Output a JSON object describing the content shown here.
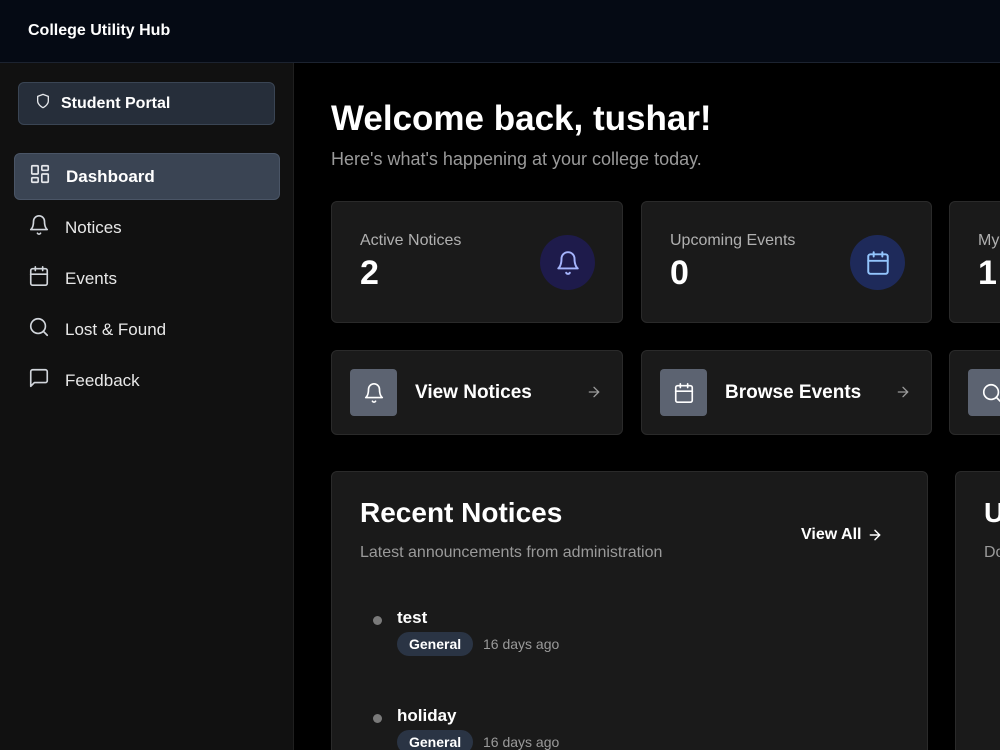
{
  "app": {
    "title": "College Utility Hub"
  },
  "sidebar": {
    "portal_label": "Student Portal",
    "items": [
      {
        "label": "Dashboard",
        "icon": "dashboard-icon",
        "active": true
      },
      {
        "label": "Notices",
        "icon": "bell-icon",
        "active": false
      },
      {
        "label": "Events",
        "icon": "calendar-icon",
        "active": false
      },
      {
        "label": "Lost & Found",
        "icon": "search-icon",
        "active": false
      },
      {
        "label": "Feedback",
        "icon": "message-icon",
        "active": false
      }
    ]
  },
  "main": {
    "welcome": "Welcome back, tushar!",
    "subtitle": "Here's what's happening at your college today.",
    "stats": [
      {
        "label": "Active Notices",
        "value": "2",
        "icon": "bell-icon",
        "icon_bg": "#1e1b4b",
        "icon_color": "#a5b4fc"
      },
      {
        "label": "Upcoming Events",
        "value": "0",
        "icon": "calendar-icon",
        "icon_bg": "#1e2a5a",
        "icon_color": "#93c5fd"
      },
      {
        "label": "My",
        "value": "1",
        "icon": "",
        "icon_bg": "",
        "icon_color": ""
      }
    ],
    "actions": [
      {
        "label": "View Notices",
        "icon": "bell-icon"
      },
      {
        "label": "Browse Events",
        "icon": "calendar-icon"
      },
      {
        "label": "",
        "icon": "search-icon"
      }
    ],
    "recent_notices": {
      "title": "Recent Notices",
      "subtitle": "Latest announcements from administration",
      "view_all": "View All",
      "items": [
        {
          "title": "test",
          "badge": "General",
          "time": "16 days ago"
        },
        {
          "title": "holiday",
          "badge": "General",
          "time": "16 days ago"
        }
      ]
    },
    "second_panel": {
      "title": "U",
      "subtitle": "Do"
    }
  },
  "colors": {
    "accent": "#3a4453",
    "background": "#000000",
    "card": "#1a1a1a"
  }
}
